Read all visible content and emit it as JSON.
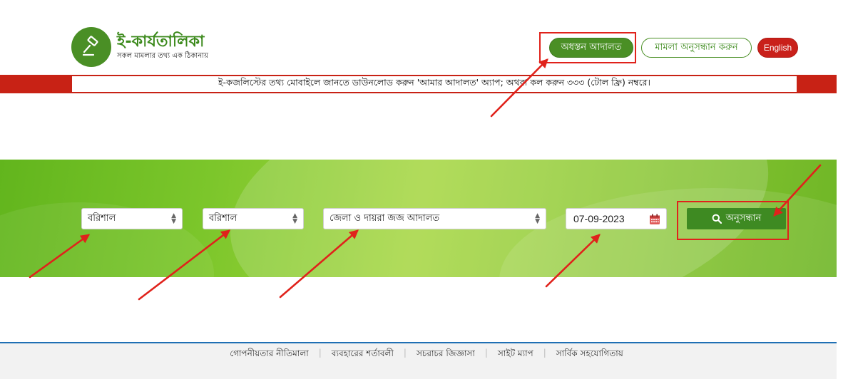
{
  "header": {
    "logo_title": "ই-কার্যতালিকা",
    "logo_subtitle": "সকল মামলার তথ্য এক ঠিকানায়",
    "nav": {
      "lower_court": "অধস্তন আদালত",
      "case_search": "মামলা অনুসন্ধান করুন",
      "english": "English"
    }
  },
  "notice": {
    "text": "ই-কজলিস্টের তথ্য মোবাইলে জানতে ডাউনলোড করুন 'আমার আদালত' অ্যাপ; অথবা কল করুন ৩৩৩ (টোল ফ্রি) নম্বরে।"
  },
  "search_form": {
    "division": "বরিশাল",
    "district": "বরিশাল",
    "court": "জেলা ও দায়রা জজ আদালত",
    "date": "07-09-2023",
    "search_button": "অনুসন্ধান"
  },
  "footer": {
    "links": [
      "গোপনীয়তার নীতিমালা",
      "ব্যবহারের শর্তাবলী",
      "সচরাচর জিজ্ঞাসা",
      "সাইট ম্যাপ",
      "সার্বিক সহযোগিতায়"
    ]
  },
  "colors": {
    "brand_green": "#4a8f25",
    "accent_red": "#c82215",
    "annotation_red": "#e0221b"
  },
  "icons": {
    "logo": "gavel-icon",
    "search": "search-icon",
    "calendar": "calendar-icon",
    "select_caret": "sort-arrows-icon"
  }
}
